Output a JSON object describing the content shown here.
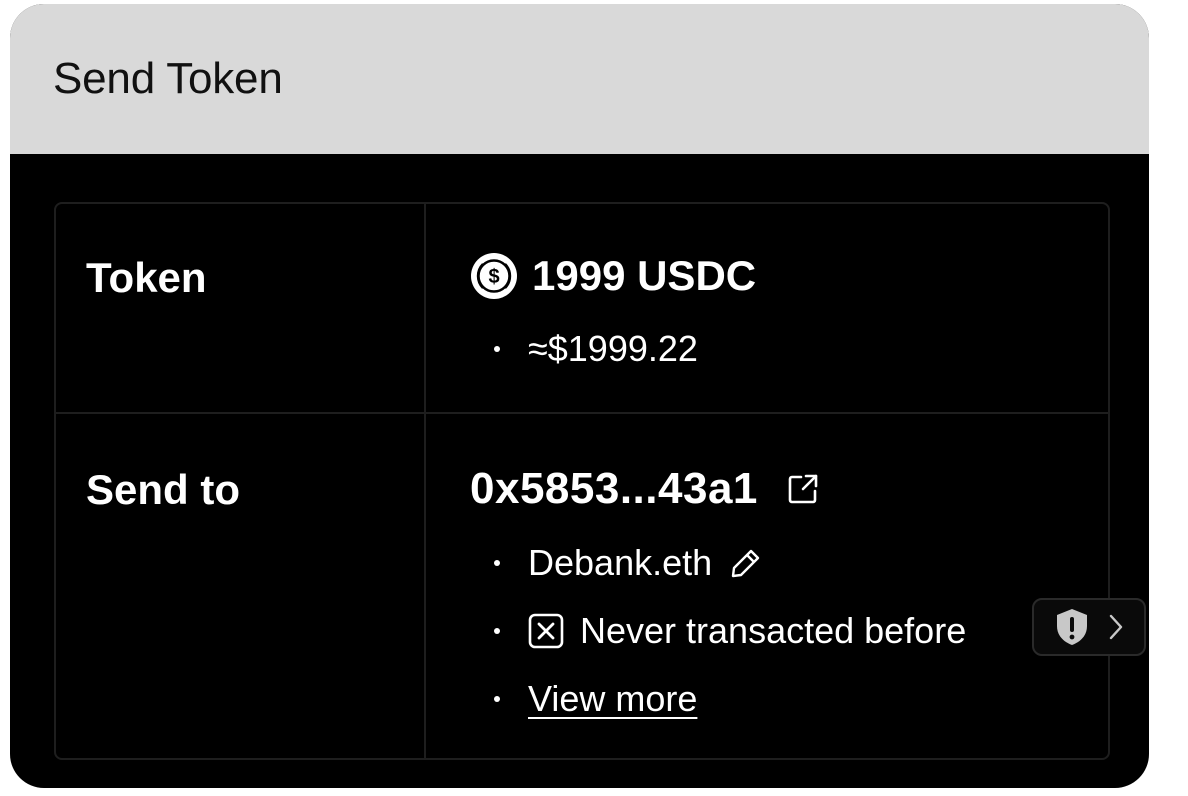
{
  "header": {
    "title": "Send Token"
  },
  "token_row": {
    "label": "Token",
    "amount": "1999 USDC",
    "token_icon": "usdc-coin-icon",
    "usd_value": "≈$1999.22"
  },
  "send_to_row": {
    "label": "Send to",
    "address": "0x5853...43a1",
    "address_action_icon": "external-link-icon",
    "alias": "Debank.eth",
    "alias_action_icon": "pencil-edit-icon",
    "history_note": "Never transacted before",
    "history_icon": "x-box-icon",
    "view_more_label": "View more"
  },
  "security_badge": {
    "icon": "shield-alert-icon",
    "chevron": "chevron-right-icon"
  },
  "colors": {
    "background": "#000000",
    "header_background": "#d9d9d9",
    "text_primary": "#ffffff",
    "border": "#1e1e1e"
  }
}
